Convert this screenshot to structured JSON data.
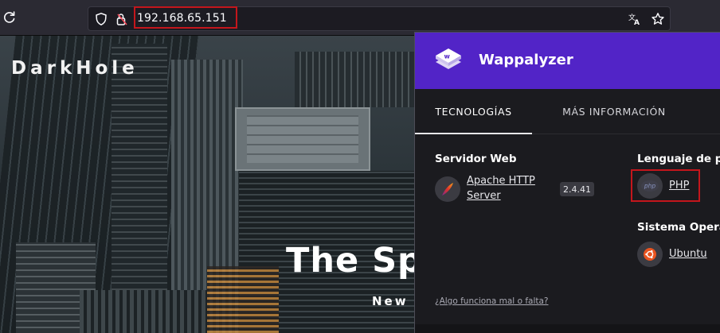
{
  "browser": {
    "url": "192.168.65.151",
    "icons": {
      "reload": "reload-icon",
      "tracking_protection": "shield-icon",
      "connection": "lock-warning-icon",
      "translate": "translate-icon",
      "bookmark": "star-icon"
    }
  },
  "page": {
    "site_name": "DarkHole",
    "hero_title": "The Sp",
    "hero_subtitle": "New a"
  },
  "wappalyzer": {
    "brand": "Wappalyzer",
    "brand_color": "#5224c7",
    "tabs": [
      {
        "label": "TECNOLOGÍAS",
        "active": true
      },
      {
        "label": "MÁS INFORMACIÓN",
        "active": false
      }
    ],
    "categories": [
      {
        "title": "Servidor Web",
        "items": [
          {
            "name_line1": "Apache HTTP",
            "name_line2": "Server",
            "version": "2.4.41",
            "icon": "apache-feather-icon"
          }
        ]
      },
      {
        "title": "Lenguaje de pro",
        "items": [
          {
            "name": "PHP",
            "icon": "php-logo-icon"
          }
        ]
      },
      {
        "title": "Sistema Operat",
        "items": [
          {
            "name": "Ubuntu",
            "icon": "ubuntu-logo-icon"
          }
        ]
      }
    ],
    "report_link": "¿Algo funciona mal o falta?",
    "php_icon_text": "php"
  }
}
